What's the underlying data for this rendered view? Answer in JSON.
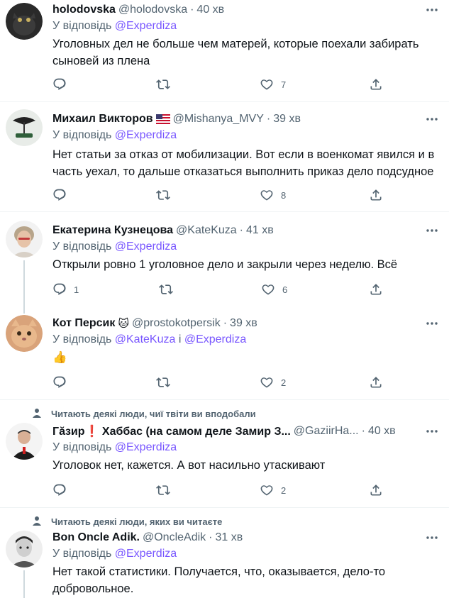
{
  "replying_prefix": "У відповідь",
  "tweets": [
    {
      "name": "holodovska",
      "handle": "@holodovska",
      "time": "40 хв",
      "replying_to": [
        "@Experdiza"
      ],
      "text": "Уголовных дел не больше чем матерей, которые поехали забирать сыновей из плена",
      "replies": "",
      "retweets": "",
      "likes": "7"
    },
    {
      "name": "Михаил Викторов",
      "badge": "flag-us",
      "handle": "@Mishanya_MVY",
      "time": "39 хв",
      "replying_to": [
        "@Experdiza"
      ],
      "text": "Нет статьи за отказ от мобилизации. Вот если в военкомат явился и в часть уехал, то дальше отказаться выполнить приказ дело подсудное",
      "replies": "",
      "retweets": "",
      "likes": "8"
    },
    {
      "name": "Екатерина Кузнецова",
      "handle": "@KateKuza",
      "time": "41 хв",
      "replying_to": [
        "@Experdiza"
      ],
      "text": "Открыли ровно 1 уголовное дело и закрыли через неделю. Всё",
      "replies": "1",
      "retweets": "",
      "likes": "6"
    },
    {
      "name": "Кот Персик",
      "badge_emoji": "🐱",
      "handle": "@prostokotpersik",
      "time": "39 хв",
      "replying_to": [
        "@KateKuza",
        "@Experdiza"
      ],
      "joiner": "і",
      "text": "👍",
      "replies": "",
      "retweets": "",
      "likes": "2"
    },
    {
      "social_context": "Читають деякі люди, чиї твіти ви вподобали",
      "name": "Гăзир❗ Хаббас (на самом деле Замир З...",
      "handle": "@GaziirHa...",
      "time": "40 хв",
      "replying_to": [
        "@Experdiza"
      ],
      "text": "Уголовок нет, кажется. А вот насильно утаскивают",
      "replies": "",
      "retweets": "",
      "likes": "2"
    },
    {
      "social_context": "Читають деякі люди, яких ви читаєте",
      "name": "Bon Oncle Adik.",
      "handle": "@OncleAdik",
      "time": "31 хв",
      "replying_to": [
        "@Experdiza"
      ],
      "text": "Нет такой статистики. Получается, что, оказывается, дело-то добровольное."
    }
  ],
  "colors": {
    "text": "#0f1419",
    "secondary": "#536471",
    "mention": "#7856ff",
    "separator": "#eff3f4",
    "thread_line": "#cfd9de"
  },
  "icons": [
    "reply-icon",
    "retweet-icon",
    "like-icon",
    "share-icon",
    "more-icon",
    "person-icon"
  ]
}
